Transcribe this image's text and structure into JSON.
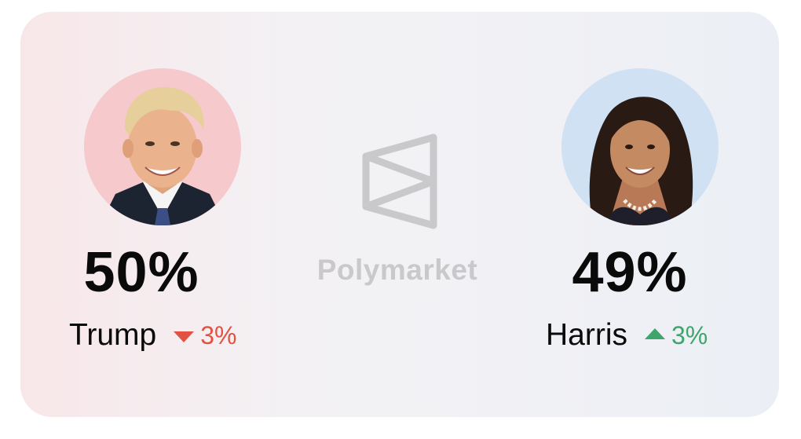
{
  "brand": {
    "name": "Polymarket",
    "logo_icon": "polymarket-logo-icon",
    "color": "#c9c9cc"
  },
  "candidates": [
    {
      "name": "Trump",
      "percent": "50%",
      "change": "3%",
      "direction": "down",
      "change_color": "#e25243",
      "avatar_bg": "#f6c9cd"
    },
    {
      "name": "Harris",
      "percent": "49%",
      "change": "3%",
      "direction": "up",
      "change_color": "#3ea56b",
      "avatar_bg": "#cfe1f3"
    }
  ]
}
